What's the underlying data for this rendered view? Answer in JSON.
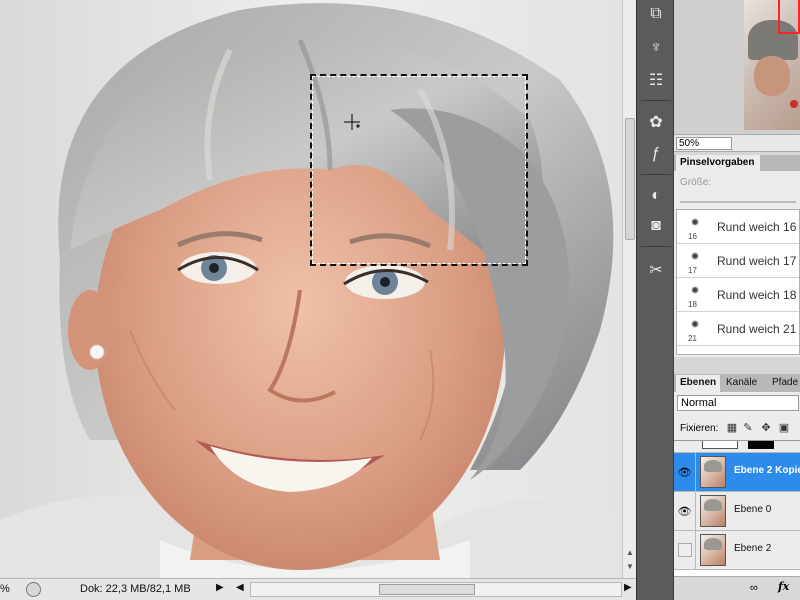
{
  "status": {
    "zoom": "%",
    "doc_info": "Dok: 22,3 MB/82,1 MB",
    "arrow": "▶",
    "left_arrow": "◀",
    "right_arrow": "▶"
  },
  "navigator": {
    "zoom": "50%"
  },
  "brushes": {
    "tab_label": "Pinselvorgaben",
    "size_label": "Größe:",
    "items": [
      {
        "name": "Rund weich 16",
        "size": "16"
      },
      {
        "name": "Rund weich 17",
        "size": "17"
      },
      {
        "name": "Rund weich 18",
        "size": "18"
      },
      {
        "name": "Rund weich 21",
        "size": "21"
      }
    ]
  },
  "layers": {
    "tabs": [
      "Ebenen",
      "Kanäle",
      "Pfade"
    ],
    "blend_mode": "Normal",
    "lock_label": "Fixieren:",
    "items": [
      {
        "name": "Ebene 2 Kopie",
        "visible": true,
        "selected": true
      },
      {
        "name": "Ebene 0",
        "visible": true,
        "selected": false
      },
      {
        "name": "Ebene 2",
        "visible": false,
        "selected": false
      }
    ],
    "footer_fx": "fx"
  },
  "icons": {
    "dock": [
      "history-icon",
      "clone-source-icon",
      "tool-presets-icon",
      "color-icon",
      "styles-icon",
      "adjustments-icon",
      "masks-icon",
      "tools-icon"
    ]
  }
}
